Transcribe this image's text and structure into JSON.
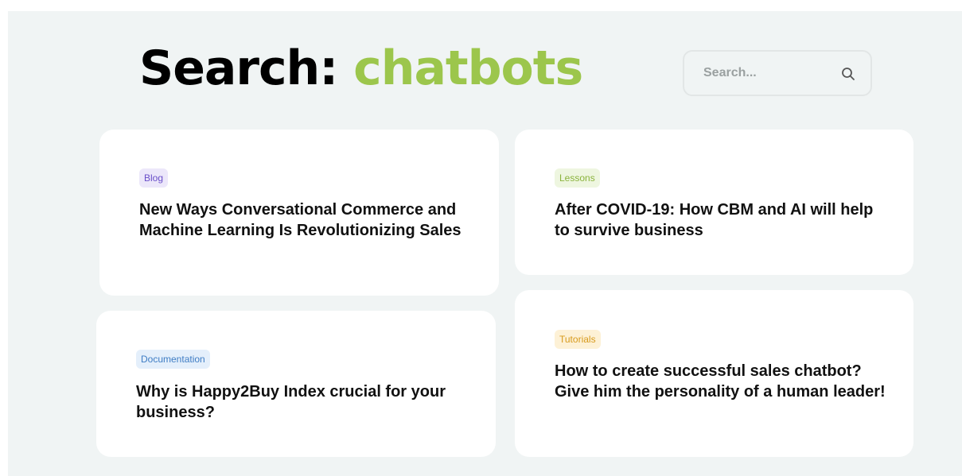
{
  "header": {
    "title_prefix": "Search: ",
    "query": "chatbots"
  },
  "search": {
    "placeholder": "Search...",
    "value": "",
    "icon": "search-icon"
  },
  "results": [
    {
      "category": "Blog",
      "title": "New Ways Conversational Commerce and Machine Learning Is Revolutionizing Sales"
    },
    {
      "category": "Lessons",
      "title": "After COVID-19: How CBM and AI will help to survive business"
    },
    {
      "category": "Documentation",
      "title": "Why is Happy2Buy Index crucial for your business?"
    },
    {
      "category": "Tutorials",
      "title": "How to create successful sales chatbot? Give him the personality of a human leader!"
    }
  ],
  "colors": {
    "accent": "#9cc64c",
    "background": "#f0f4f4",
    "blog_badge": "#6a4fc9",
    "lessons_badge": "#8ab33c",
    "documentation_badge": "#3f7dc4",
    "tutorials_badge": "#d79a1c"
  }
}
